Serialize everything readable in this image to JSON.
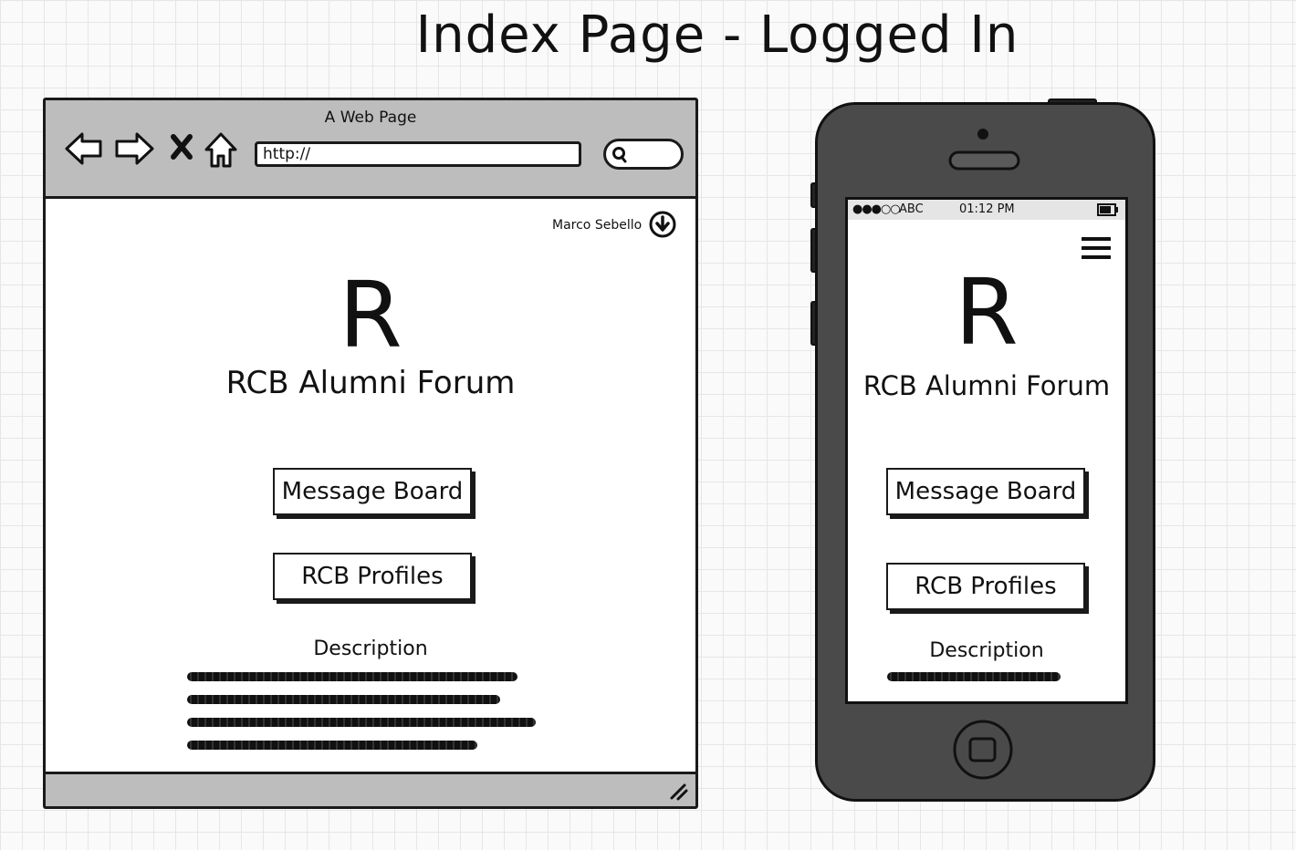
{
  "page_title": "Index Page - Logged In",
  "browser": {
    "window_title": "A Web Page",
    "url_value": "http://",
    "nav_icons": [
      "back-icon",
      "forward-icon",
      "close-icon",
      "home-icon"
    ],
    "search_icon": "search-icon",
    "user_name": "Marco Sebello",
    "user_menu_icon": "arrow-down-circle-icon",
    "logo_letter": "R",
    "app_name": "RCB Alumni Forum",
    "buttons": {
      "message_board": "Message Board",
      "profiles": "RCB Profiles"
    },
    "description_heading": "Description",
    "resize_icon": "resize-grip-icon"
  },
  "phone": {
    "status": {
      "signal": "●●●○○",
      "carrier": "ABC",
      "time": "01:12 PM",
      "battery_icon": "battery-icon"
    },
    "menu_icon": "hamburger-menu-icon",
    "logo_letter": "R",
    "app_name": "RCB Alumni Forum",
    "buttons": {
      "message_board": "Message Board",
      "profiles": "RCB Profiles"
    },
    "description_heading": "Description"
  },
  "colors": {
    "chrome_gray": "#bdbdbd",
    "phone_body": "#4a4a4a",
    "ink": "#111111"
  }
}
